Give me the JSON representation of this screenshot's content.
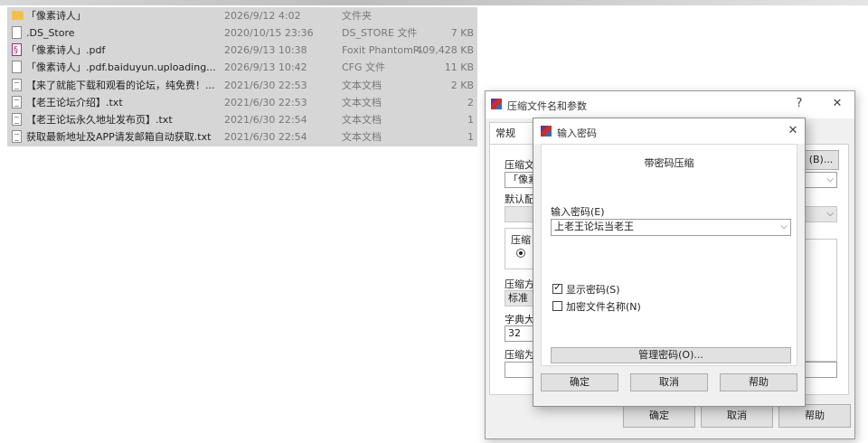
{
  "files": [
    {
      "icon": "folder",
      "name": "「像素诗人」",
      "date": "2026/9/12 4:02",
      "type": "文件夹",
      "size": ""
    },
    {
      "icon": "file",
      "name": ".DS_Store",
      "date": "2020/10/15 23:36",
      "type": "DS_STORE 文件",
      "size": "7 KB"
    },
    {
      "icon": "pdf",
      "name": "「像素诗人」.pdf",
      "date": "2026/9/13 10:38",
      "type": "Foxit PhantomP...",
      "size": "409,428 KB"
    },
    {
      "icon": "file",
      "name": "「像素诗人」.pdf.baiduyun.uploading...",
      "date": "2026/9/13 10:42",
      "type": "CFG 文件",
      "size": "11 KB"
    },
    {
      "icon": "txt",
      "name": "【来了就能下载和观看的论坛，纯免费！...",
      "date": "2021/6/30 22:53",
      "type": "文本文档",
      "size": "2 KB"
    },
    {
      "icon": "txt",
      "name": "【老王论坛介绍】.txt",
      "date": "2021/6/30 22:53",
      "type": "文本文档",
      "size": "2"
    },
    {
      "icon": "txt",
      "name": "【老王论坛永久地址发布页】.txt",
      "date": "2021/6/30 22:54",
      "type": "文本文档",
      "size": "1"
    },
    {
      "icon": "txt",
      "name": "获取最新地址及APP请发邮箱自动获取.txt",
      "date": "2021/6/30 22:54",
      "type": "文本文档",
      "size": "1"
    }
  ],
  "archive_dialog": {
    "title": "压缩文件名和参数",
    "help_glyph": "?",
    "close_glyph": "✕",
    "tab_general": "常规",
    "archive_name_label": "压缩文",
    "archive_name_value": "「像素",
    "browse_button": "(B)...",
    "default_profile_label": "默认配",
    "format_label": "压缩",
    "method_label": "压缩方",
    "method_value": "标准",
    "dict_label": "字典大",
    "dict_value": "32",
    "split_label": "压缩为",
    "ok": "确定",
    "cancel": "取消",
    "help": "帮助"
  },
  "password_dialog": {
    "title": "输入密码",
    "close_glyph": "✕",
    "heading": "带密码压缩",
    "password_label": "输入密码(E)",
    "password_value": "上老王论坛当老王",
    "show_password_label": "显示密码(S)",
    "show_password_checked": true,
    "encrypt_names_label": "加密文件名称(N)",
    "encrypt_names_checked": false,
    "manage_button": "管理密码(O)...",
    "ok": "确定",
    "cancel": "取消",
    "help": "帮助"
  }
}
